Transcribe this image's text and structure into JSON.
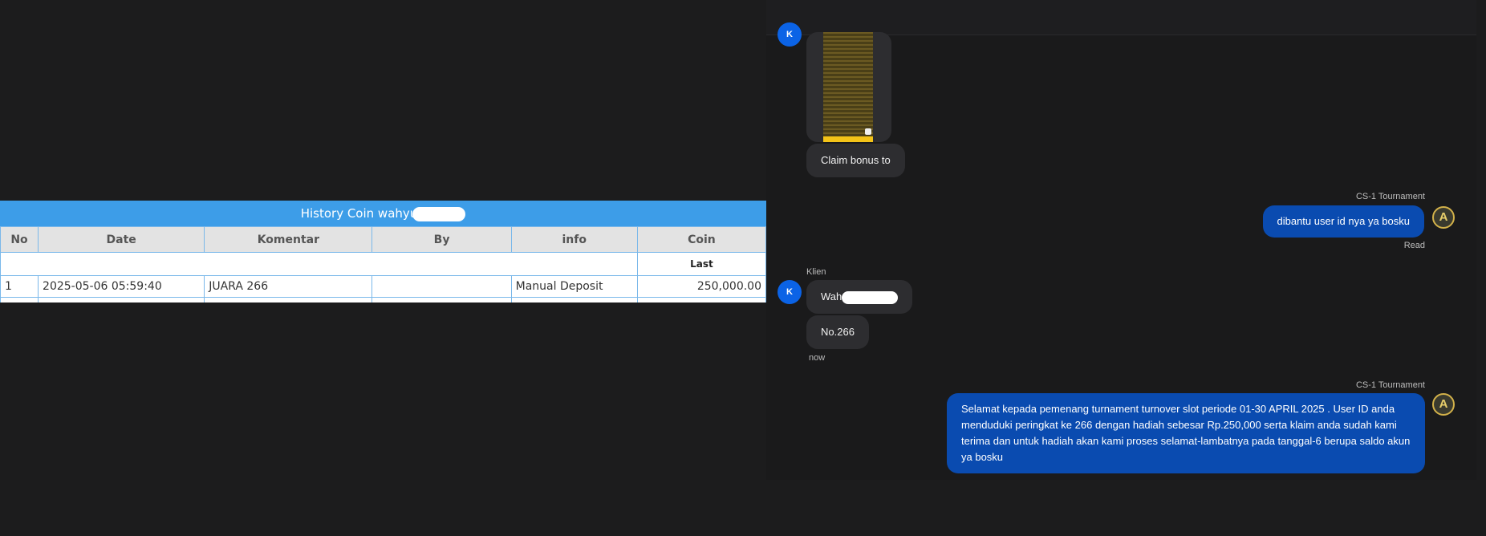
{
  "history": {
    "title": "History Coin wahyu",
    "columns": [
      "No",
      "Date",
      "Komentar",
      "By",
      "info",
      "Coin"
    ],
    "sub_header": "Last",
    "rows": [
      {
        "no": "1",
        "date": "2025-05-06 05:59:40",
        "komentar": "JUARA 266",
        "by": "",
        "info": "Manual Deposit",
        "coin": "250,000.00"
      }
    ]
  },
  "chat": {
    "messages": {
      "claim": "Claim bonus to",
      "agent1_sender": "CS-1 Tournament",
      "agent1_text": "dibantu user id nya ya bosku",
      "agent1_status": "Read",
      "client_sender": "Klien",
      "client_avatar": "K",
      "client_text1": "Wah",
      "client_text2": "No.266",
      "client_time": "now",
      "agent2_sender": "CS-1 Tournament",
      "agent2_text": "Selamat kepada pemenang turnament turnover slot periode 01-30 APRIL 2025 . User ID anda menduduki peringkat ke 266 dengan hadiah sebesar Rp.250,000 serta klaim anda sudah kami terima dan untuk hadiah akan kami proses selamat-lambatnya pada tanggal-6 berupa saldo akun ya bosku"
    },
    "agent_avatar_letter": "A",
    "colors": {
      "outgoing": "#0a4bb0",
      "incoming": "#2d2d30",
      "header_bar": "#3d9de8",
      "coin": "#2a9a26"
    }
  }
}
